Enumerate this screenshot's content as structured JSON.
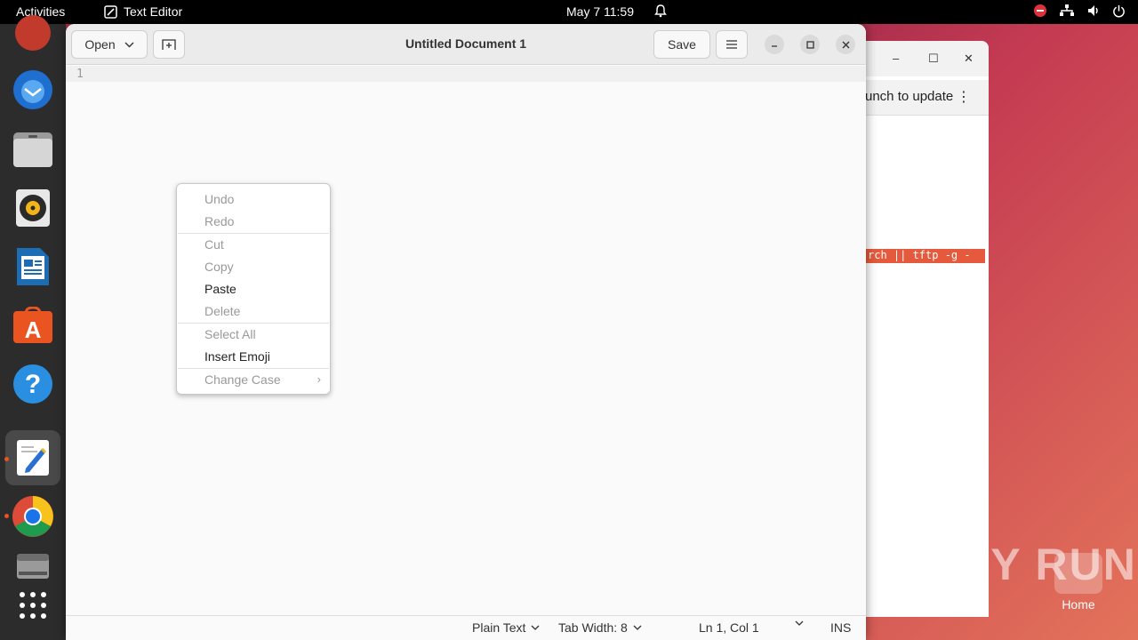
{
  "topbar": {
    "activities": "Activities",
    "app_name": "Text Editor",
    "clock": "May 7  11:59"
  },
  "dock": {
    "items": [
      "ubuntu-icon",
      "thunderbird-icon",
      "files-icon",
      "rhythmbox-icon",
      "writer-icon",
      "app-center-icon",
      "help-icon",
      "text-editor-icon",
      "chrome-icon",
      "storage-icon",
      "app-grid-icon"
    ]
  },
  "background_window": {
    "update_text": "unch to update",
    "terminal_text": "rch || tftp -g -"
  },
  "desktop": {
    "home_label": "Home",
    "watermark": "ANY RUN"
  },
  "editor": {
    "open_label": "Open",
    "save_label": "Save",
    "title": "Untitled Document 1",
    "line_number": "1",
    "status": {
      "language": "Plain Text",
      "tab_width": "Tab Width: 8",
      "position": "Ln 1, Col 1",
      "mode": "INS"
    }
  },
  "context_menu": {
    "undo": "Undo",
    "redo": "Redo",
    "cut": "Cut",
    "copy": "Copy",
    "paste": "Paste",
    "delete": "Delete",
    "select_all": "Select All",
    "insert_emoji": "Insert Emoji",
    "change_case": "Change Case"
  },
  "colors": {
    "accent": "#e95420",
    "terminal_highlight": "#e55a3c"
  }
}
